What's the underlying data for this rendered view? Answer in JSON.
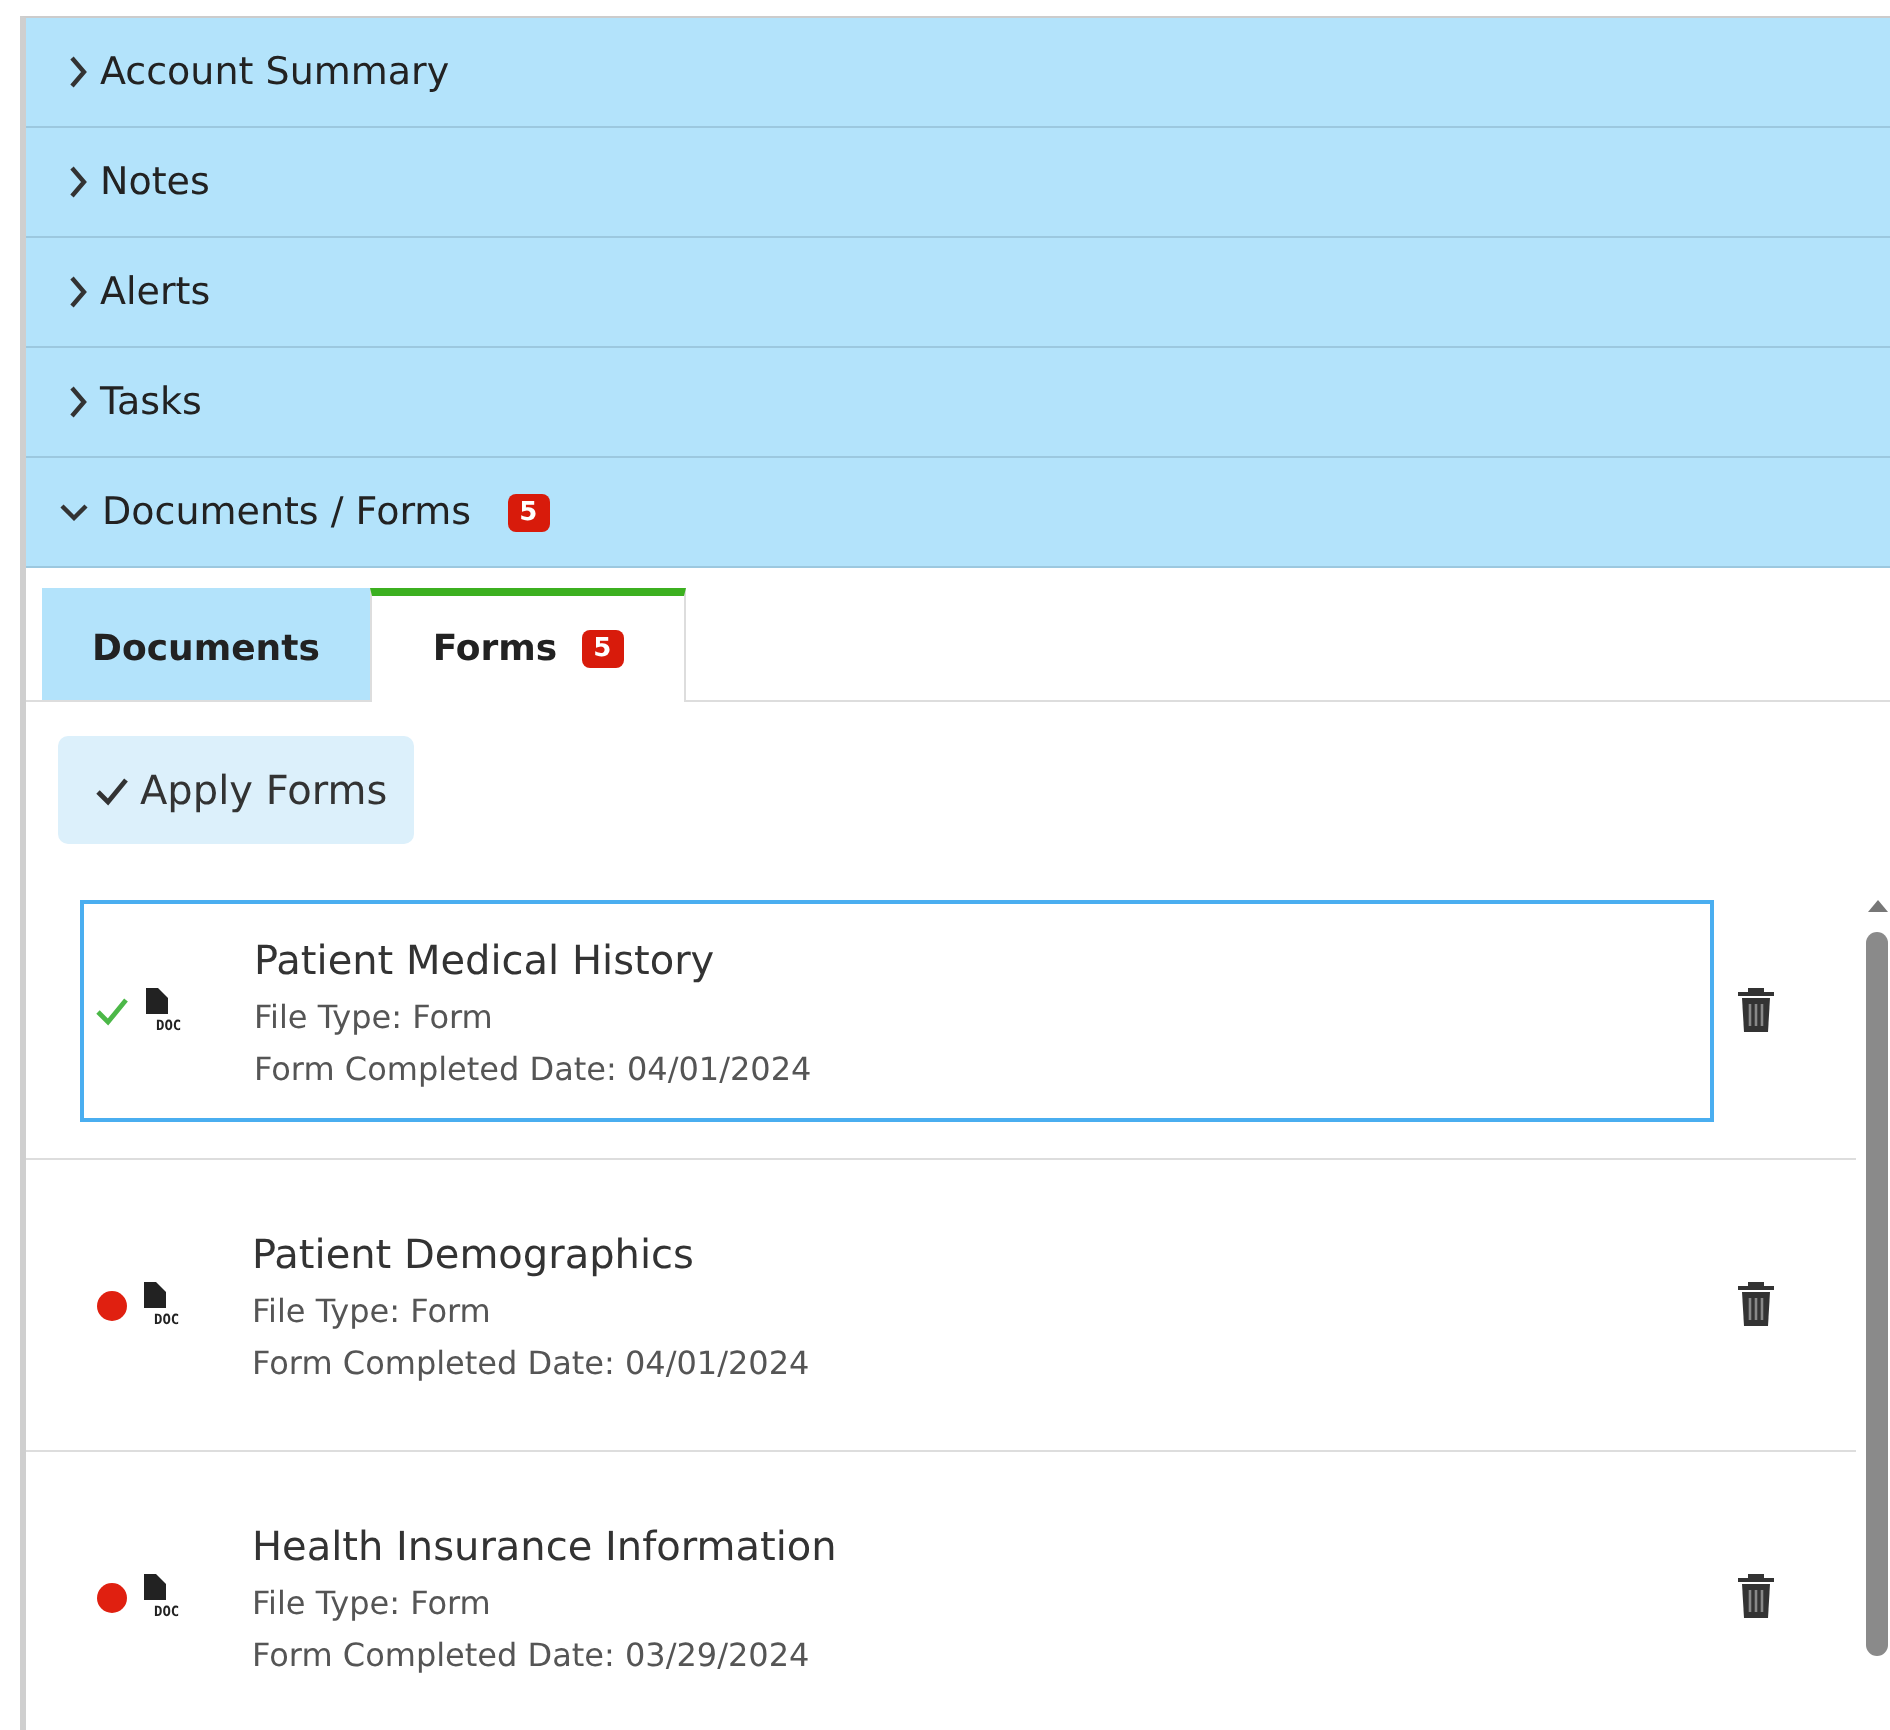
{
  "sections": [
    {
      "title": "Account Summary",
      "expanded": false
    },
    {
      "title": "Notes",
      "expanded": false
    },
    {
      "title": "Alerts",
      "expanded": false
    },
    {
      "title": "Tasks",
      "expanded": false
    },
    {
      "title": "Documents / Forms",
      "expanded": true,
      "badge": "5"
    }
  ],
  "tabs": [
    {
      "label": "Documents",
      "selected": false
    },
    {
      "label": "Forms",
      "selected": true,
      "badge": "5"
    }
  ],
  "apply_button": "Apply Forms",
  "forms": [
    {
      "title": "Patient Medical History",
      "done": true,
      "selected": true,
      "icon_label": "DOC",
      "file_type": "File Type: Form",
      "completed": "Form Completed Date: 04/01/2024"
    },
    {
      "title": "Patient Demographics",
      "done": false,
      "selected": false,
      "icon_label": "DOC",
      "file_type": "File Type: Form",
      "completed": "Form Completed Date: 04/01/2024"
    },
    {
      "title": "Health Insurance Information",
      "done": false,
      "selected": false,
      "icon_label": "DOC",
      "file_type": "File Type: Form",
      "completed": "Form Completed Date: 03/29/2024"
    }
  ]
}
